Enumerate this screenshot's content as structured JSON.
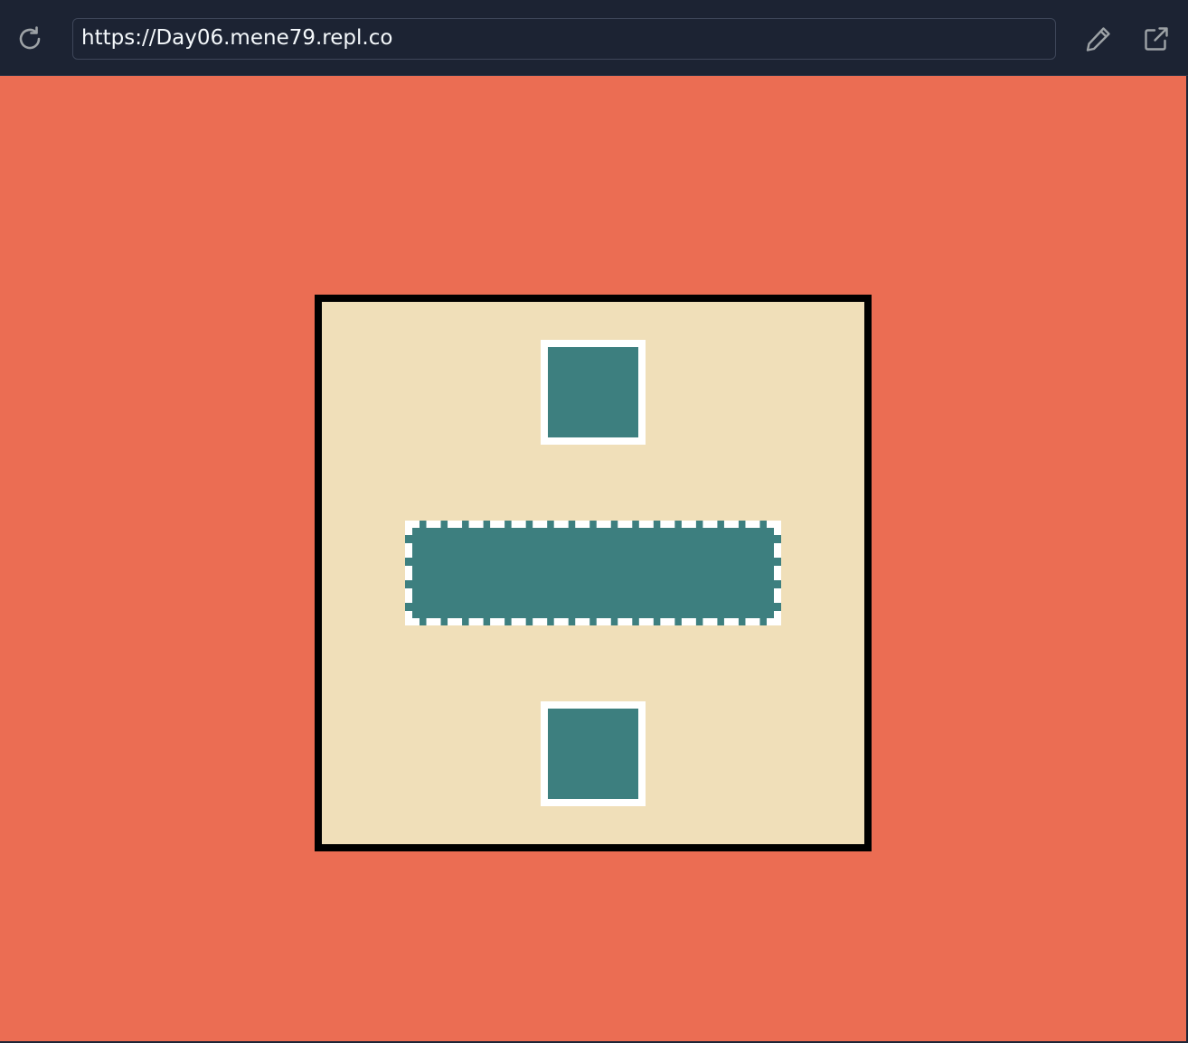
{
  "browser": {
    "url": "https://Day06.mene79.repl.co",
    "icons": {
      "reload": "reload-icon",
      "edit": "pencil-icon",
      "open_external": "external-link-icon"
    }
  },
  "colors": {
    "toolbar_bg": "#1c2333",
    "page_bg": "#eb6d53",
    "frame_bg": "#f0dfb9",
    "frame_border": "#000000",
    "shape_fill": "#3d7f7f",
    "shape_border": "#ffffff"
  }
}
